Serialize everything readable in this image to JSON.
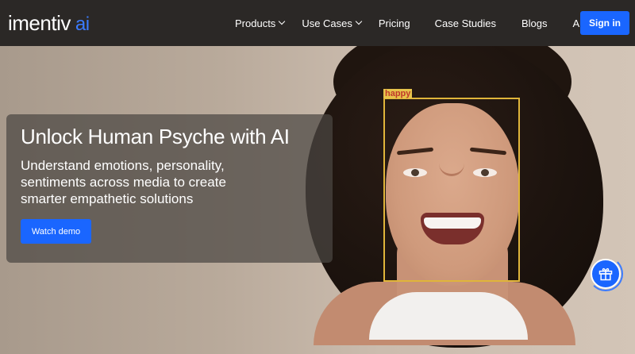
{
  "brand": {
    "name": "imentiv",
    "suffix": "ai",
    "accent": "#1a66ff"
  },
  "nav": {
    "items": [
      {
        "label": "Products",
        "dropdown": true
      },
      {
        "label": "Use Cases",
        "dropdown": true
      },
      {
        "label": "Pricing",
        "dropdown": false
      },
      {
        "label": "Case Studies",
        "dropdown": false
      },
      {
        "label": "Blogs",
        "dropdown": false
      },
      {
        "label": "APIs",
        "dropdown": true
      }
    ],
    "signin_label": "Sign in"
  },
  "hero": {
    "title": "Unlock Human Psyche with AI",
    "subtitle": "Understand emotions, personality, sentiments across media to create smarter empathetic solutions",
    "cta_label": "Watch demo"
  },
  "detection": {
    "label": "happy",
    "box_color": "#e0b53a",
    "label_color": "#c0392b"
  },
  "widgets": {
    "gift_icon": "gift-icon"
  }
}
